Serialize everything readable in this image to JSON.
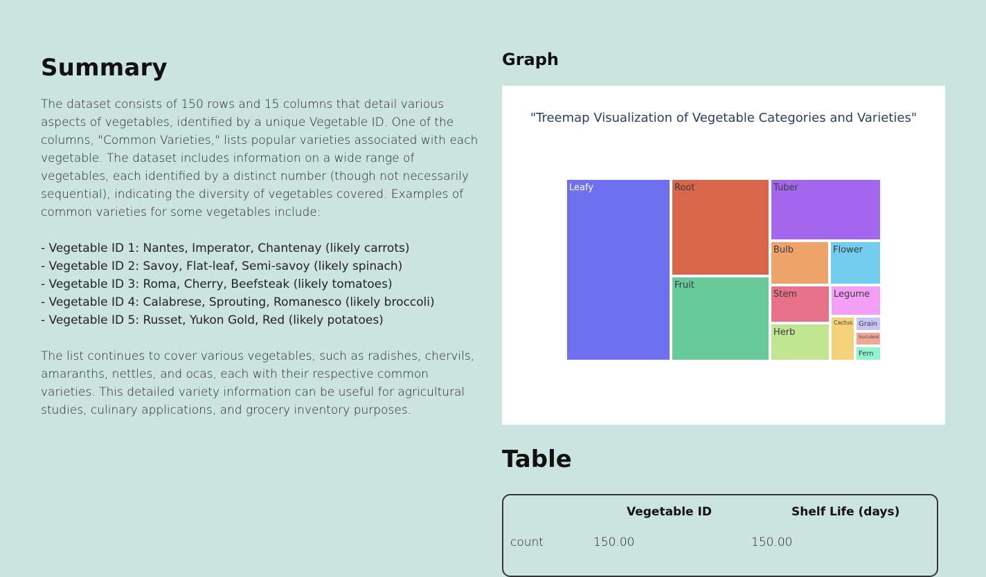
{
  "summary": {
    "heading": "Summary",
    "paragraph1": "The dataset consists of 150 rows and 15 columns that detail various\naspects of vegetables, identified by a unique Vegetable ID. One of the\ncolumns, \"Common Varieties,\" lists popular varieties associated with each\nvegetable. The dataset includes information on a wide range of\nvegetables, each identified by a distinct number (though not necessarily\nsequential), indicating the diversity of vegetables covered. Examples of\ncommon varieties for some vegetables include:",
    "bullets": [
      "- Vegetable ID 1: Nantes, Imperator, Chantenay (likely carrots)",
      "- Vegetable ID 2: Savoy, Flat-leaf, Semi-savoy (likely spinach)",
      "- Vegetable ID 3: Roma, Cherry, Beefsteak (likely tomatoes)",
      "- Vegetable ID 4: Calabrese, Sprouting, Romanesco (likely broccoli)",
      "- Vegetable ID 5: Russet, Yukon Gold, Red (likely potatoes)"
    ],
    "paragraph2": "The list continues to cover various vegetables, such as radishes, chervils,\namaranths, nettles, and ocas, each with their respective common\nvarieties. This detailed variety information can be useful for agricultural\nstudies, culinary applications, and grocery inventory purposes."
  },
  "graph": {
    "heading": "Graph"
  },
  "chart_data": {
    "type": "treemap",
    "title": "\"Treemap Visualization of Vegetable Categories and Varieties\"",
    "items": [
      {
        "label": "Leafy",
        "value": 36,
        "color": "#6e70ef"
      },
      {
        "label": "Root",
        "value": 18,
        "color": "#d9654b"
      },
      {
        "label": "Fruit",
        "value": 15,
        "color": "#68c99b"
      },
      {
        "label": "Tuber",
        "value": 12,
        "color": "#a367ee"
      },
      {
        "label": "Bulb",
        "value": 7,
        "color": "#eca46a"
      },
      {
        "label": "Flower",
        "value": 6,
        "color": "#73cdee"
      },
      {
        "label": "Stem",
        "value": 6,
        "color": "#e77289"
      },
      {
        "label": "Herb",
        "value": 6,
        "color": "#c1e591"
      },
      {
        "label": "Legume",
        "value": 4,
        "color": "#f39ef7"
      },
      {
        "label": "Cactus",
        "value": 3,
        "color": "#f3d27a"
      },
      {
        "label": "Grain",
        "value": 1,
        "color": "#c9c5f7"
      },
      {
        "label": "Succulent",
        "value": 1,
        "color": "#f0a894"
      },
      {
        "label": "Fern",
        "value": 1,
        "color": "#8ff5cf"
      }
    ]
  },
  "table": {
    "heading": "Table",
    "columns": [
      "Vegetable ID",
      "Shelf Life (days)"
    ],
    "rows": [
      {
        "label": "count",
        "values": [
          "150.00",
          "150.00"
        ]
      }
    ]
  }
}
